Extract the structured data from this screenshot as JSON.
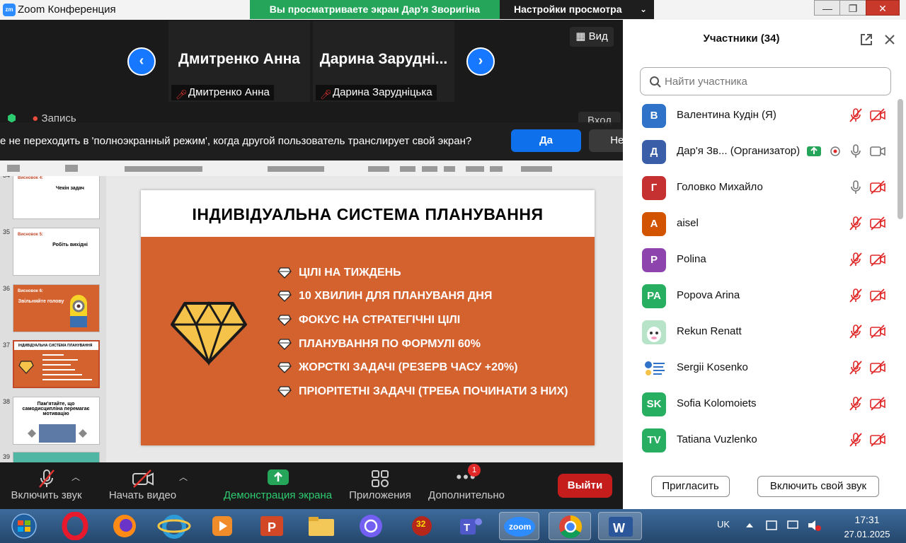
{
  "window": {
    "logo_text": "zm",
    "title": "Zoom Конференция",
    "share_banner": "Вы просматриваете экран Дар'я Зворигіна",
    "view_options": "Настройки просмотра",
    "minimize": "—",
    "maximize": "❐",
    "close": "✕"
  },
  "gallery": {
    "prev": "‹",
    "next": "›",
    "view_label": "Вид",
    "tiles": [
      {
        "big_name": "Дмитренко Анна",
        "label": "Дмитренко Анна"
      },
      {
        "big_name": "Дарина  Заруднi...",
        "label": "Дарина Заруднiцька"
      }
    ]
  },
  "overlay": {
    "record": "Запись",
    "enter": "Вход",
    "prompt": "е не переходить в 'полноэкранный режим', когда другой пользователь транслирует свой экран?",
    "yes": "Да",
    "no": "Нет"
  },
  "ppt": {
    "thumbs": [
      {
        "num": "34",
        "tt": "Висновок 4:",
        "tb": "Чекін задач",
        "style": "white"
      },
      {
        "num": "35",
        "tt": "Висновок 5:",
        "tb": "Робіть вихідні",
        "style": "white"
      },
      {
        "num": "36",
        "tt": "Висновок 6:",
        "tb": "Звільняйте голову",
        "style": "orange"
      },
      {
        "num": "37",
        "tt": "ІНДИВІДУАЛЬНА СИСТЕМА ПЛАНУВАННЯ",
        "tb": "",
        "style": "sel"
      },
      {
        "num": "38",
        "tt": "",
        "tb": "Пам'ятайте, що самодисципліна перемагає мотивацію",
        "style": "white"
      },
      {
        "num": "39",
        "tt": "",
        "tb": "",
        "style": "teal"
      }
    ],
    "slide_title": "ІНДИВІДУАЛЬНА СИСТЕМА ПЛАНУВАННЯ",
    "bullets": [
      "ЦІЛІ НА ТИЖДЕНЬ",
      "10 ХВИЛИН ДЛЯ ПЛАНУВАНЯ ДНЯ",
      "ФОКУС НА СТРАТЕГІЧНІ ЦІЛІ",
      "ПЛАНУВАННЯ ПО ФОРМУЛІ 60%",
      "ЖОРСТКІ ЗАДАЧІ (РЕЗЕРВ ЧАСУ +20%)",
      "ПРІОРІТЕТНІ ЗАДАЧІ (ТРЕБА ПОЧИНАТИ З НИХ)"
    ],
    "accent": "#d4622f"
  },
  "toolbar": {
    "unmute": "Включить звук",
    "start_video": "Начать видео",
    "share_screen": "Демонстрация экрана",
    "apps": "Приложения",
    "more": "Дополнительно",
    "more_badge": "1",
    "leave": "Выйти"
  },
  "participants": {
    "title": "Участники (34)",
    "search_placeholder": "Найти участника",
    "invite": "Пригласить",
    "enable_audio": "Включить свой звук",
    "list": [
      {
        "initials": "В",
        "name": "Валентина Кудін (Я)",
        "color": "#2f73c9",
        "mic": "muted",
        "video": "off"
      },
      {
        "initials": "Д",
        "name": "Дар'я Зв... (Организатор)",
        "color": "#3a5fa8",
        "mic": "on",
        "video": "on"
      },
      {
        "initials": "Г",
        "name": "Головко Михайло",
        "color": "#c53030",
        "mic": "on",
        "video": "off"
      },
      {
        "initials": "A",
        "name": "aisel",
        "color": "#d35400",
        "mic": "muted",
        "video": "off"
      },
      {
        "initials": "P",
        "name": "Polina",
        "color": "#8e44ad",
        "mic": "muted",
        "video": "off"
      },
      {
        "initials": "PA",
        "name": "Popova Arina",
        "color": "#27ae60",
        "mic": "muted",
        "video": "off"
      },
      {
        "initials": "",
        "name": "Rekun Renatt",
        "color": "#b7e3c8",
        "mic": "muted",
        "video": "off"
      },
      {
        "initials": "",
        "name": "Sergii Kosenko",
        "color": "#e8eef8",
        "mic": "muted",
        "video": "off"
      },
      {
        "initials": "SK",
        "name": "Sofia Kolomoiets",
        "color": "#27ae60",
        "mic": "muted",
        "video": "off"
      },
      {
        "initials": "TV",
        "name": "Tatiana Vuzlenko",
        "color": "#27ae60",
        "mic": "muted",
        "video": "off"
      }
    ]
  },
  "taskbar": {
    "lang": "UK",
    "time": "17:31",
    "date": "27.01.2025",
    "badge_32": "32"
  }
}
